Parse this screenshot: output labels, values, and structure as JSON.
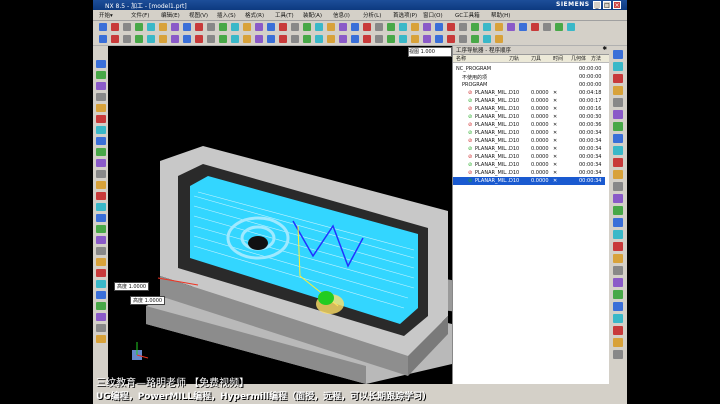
{
  "window": {
    "title": "NX 8.5 - 加工 - [model1.prt]",
    "brand": "SIEMENS",
    "minimize": "_",
    "maximize": "□",
    "close": "×"
  },
  "menu": {
    "items": [
      "开始▾",
      "文件(F)",
      "编辑(E)",
      "视图(V)",
      "插入(S)",
      "格式(R)",
      "工具(T)",
      "装配(A)",
      "信息(I)",
      "分析(L)",
      "首选项(P)",
      "窗口(O)",
      "GC工具箱",
      "帮助(H)"
    ]
  },
  "viewport": {
    "zoom_label": "视图",
    "zoom_value": "1.000",
    "dim_label_1": "高度",
    "dim_value_1": "1.0000",
    "dim_label_2": "高度",
    "dim_value_2": "1.0000"
  },
  "navigator": {
    "title": "工序导航器 - 程序顺序",
    "columns": [
      "名称",
      "刀轨",
      "刀具",
      "时间",
      "几何体",
      "方法"
    ],
    "rows": [
      {
        "name": "NC_PROGRAM",
        "path": "",
        "tool": "",
        "time": "00:00:00",
        "level": 0
      },
      {
        "name": "不使用的项",
        "path": "",
        "tool": "",
        "time": "00:00:00",
        "level": 1
      },
      {
        "name": "PROGRAM",
        "path": "",
        "tool": "",
        "time": "00:00:00",
        "level": 1
      },
      {
        "name": "PLANAR_MIL...",
        "path": "D10",
        "tool": "0.0000",
        "time": "00:04:18",
        "level": 2
      },
      {
        "name": "PLANAR_MIL...",
        "path": "D10",
        "tool": "0.0000",
        "time": "00:00:17",
        "level": 2
      },
      {
        "name": "PLANAR_MIL...",
        "path": "D10",
        "tool": "0.0000",
        "time": "00:00:16",
        "level": 2
      },
      {
        "name": "PLANAR_MIL...",
        "path": "D10",
        "tool": "0.0000",
        "time": "00:00:30",
        "level": 2
      },
      {
        "name": "PLANAR_MIL...",
        "path": "D10",
        "tool": "0.0000",
        "time": "00:00:36",
        "level": 2
      },
      {
        "name": "PLANAR_MIL...",
        "path": "D10",
        "tool": "0.0000",
        "time": "00:00:34",
        "level": 2
      },
      {
        "name": "PLANAR_MIL...",
        "path": "D10",
        "tool": "0.0000",
        "time": "00:00:34",
        "level": 2
      },
      {
        "name": "PLANAR_MIL...",
        "path": "D10",
        "tool": "0.0000",
        "time": "00:00:34",
        "level": 2
      },
      {
        "name": "PLANAR_MIL...",
        "path": "D10",
        "tool": "0.0000",
        "time": "00:00:34",
        "level": 2
      },
      {
        "name": "PLANAR_MIL...",
        "path": "D10",
        "tool": "0.0000",
        "time": "00:00:34",
        "level": 2
      },
      {
        "name": "PLANAR_MIL...",
        "path": "D10",
        "tool": "0.0000",
        "time": "00:00:34",
        "level": 2
      },
      {
        "name": "PLANAR_MIL...",
        "path": "D10",
        "tool": "0.0000",
        "time": "00:00:34",
        "level": 2
      }
    ],
    "selected_index": 14
  },
  "caption": {
    "line1": "三纹教育—路明老师 【免费视频】",
    "line2": "UG编程，PowerMILL编程，Hypermill编程（面授，远程，可以长期跟踪学习）"
  },
  "colors": {
    "cyan_toolpath": "#33d6ff",
    "part_gray": "#c8c8c8",
    "selected_row": "#1a5ad0"
  }
}
